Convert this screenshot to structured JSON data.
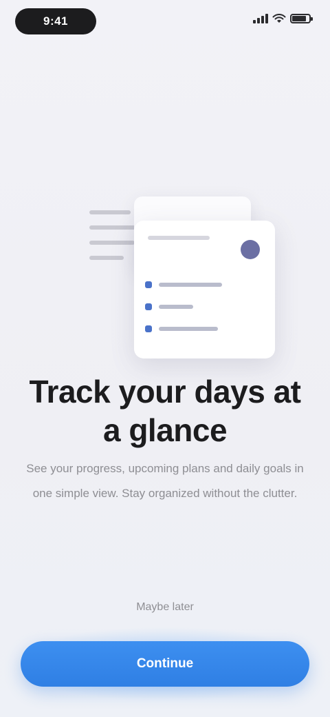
{
  "status_bar": {
    "time": "9:41"
  },
  "illustration": {
    "icons": [
      "list-lines",
      "calendar-card",
      "user-avatar"
    ]
  },
  "content": {
    "headline": "Track your days at a glance",
    "body": "See your progress, upcoming plans and daily goals in one simple view. Stay organized without the clutter."
  },
  "actions": {
    "secondary_label": "Maybe later",
    "primary_label": "Continue"
  },
  "colors": {
    "background": "#efeff4",
    "accent": "#2f7fe4",
    "headline": "#1c1c1e",
    "body": "#8e8e93"
  }
}
